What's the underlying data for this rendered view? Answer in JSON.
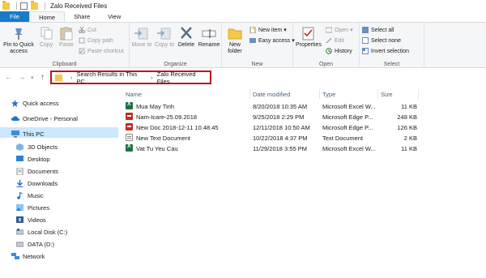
{
  "window": {
    "title": "Zalo Received Files"
  },
  "tabs": [
    "File",
    "Home",
    "Share",
    "View"
  ],
  "ribbon": {
    "clipboard": {
      "label": "Clipboard",
      "pin": "Pin to Quick access",
      "copy": "Copy",
      "paste": "Paste",
      "cut": "Cut",
      "copy_path": "Copy path",
      "paste_shortcut": "Paste shortcut"
    },
    "organize": {
      "label": "Organize",
      "move_to": "Move to",
      "copy_to": "Copy to",
      "delete": "Delete",
      "rename": "Rename"
    },
    "new": {
      "label": "New",
      "new_folder": "New folder",
      "new_item": "New item",
      "easy_access": "Easy access"
    },
    "open": {
      "label": "Open",
      "properties": "Properties",
      "open": "Open",
      "edit": "Edit",
      "history": "History"
    },
    "select": {
      "label": "Select",
      "select_all": "Select all",
      "select_none": "Select none",
      "invert": "Invert selection"
    }
  },
  "address": {
    "segments": [
      "Search Results in This PC",
      "Zalo Received Files"
    ]
  },
  "nav_pane": {
    "quick_access": "Quick access",
    "onedrive": "OneDrive - Personal",
    "this_pc": "This PC",
    "items": [
      "3D Objects",
      "Desktop",
      "Documents",
      "Downloads",
      "Music",
      "Pictures",
      "Videos",
      "Local Disk (C:)",
      "DATA (D:)"
    ],
    "network": "Network"
  },
  "columns": {
    "name": "Name",
    "date": "Date modified",
    "type": "Type",
    "size": "Size"
  },
  "files": [
    {
      "icon": "excel-icon",
      "name": "Mua May Tinh",
      "date": "8/20/2018 10:35 AM",
      "type": "Microsoft Excel W...",
      "size": "11 KB"
    },
    {
      "icon": "pdf-icon",
      "name": "Nam-Icare-25.09.2018",
      "date": "9/25/2018 2:29 PM",
      "type": "Microsoft Edge P...",
      "size": "248 KB"
    },
    {
      "icon": "pdf-icon",
      "name": "New Doc 2018-12-11 10.48.45",
      "date": "12/11/2018 10:50 AM",
      "type": "Microsoft Edge P...",
      "size": "126 KB"
    },
    {
      "icon": "text-file-icon",
      "name": "New Text Document",
      "date": "10/22/2018 4:37 PM",
      "type": "Text Document",
      "size": "2 KB"
    },
    {
      "icon": "excel-icon",
      "name": "Vat Tu Yeu Cau",
      "date": "11/29/2018 3:55 PM",
      "type": "Microsoft Excel W...",
      "size": "11 KB"
    }
  ],
  "colors": {
    "accent": "#1979ca",
    "highlight": "#c0151b",
    "selection": "#cce8ff"
  }
}
